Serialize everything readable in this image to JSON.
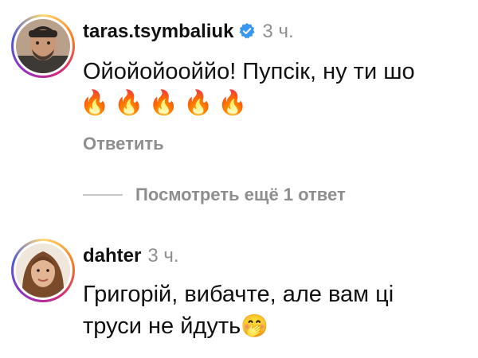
{
  "comments": [
    {
      "username": "taras.tsymbaliuk",
      "verified": true,
      "time": "3 ч.",
      "text": "Ойойойооййо! Пупсік, ну ти шо",
      "emoji_line": "🔥🔥🔥🔥🔥",
      "reply_label": "Ответить"
    },
    {
      "username": "dahter",
      "verified": false,
      "time": "3 ч.",
      "text_line1": "Григорій, вибачте, але вам ці",
      "text_line2": "труси не йдуть",
      "emoji": "🤭"
    }
  ],
  "view_more_replies": "Посмотреть ещё 1 ответ",
  "colors": {
    "secondary_text": "#8e8e8e",
    "verified_badge": "#3897f0"
  },
  "icons": {
    "verified": "verified-badge-icon",
    "fire": "fire-emoji",
    "hand_over_mouth": "hand-over-mouth-emoji"
  }
}
